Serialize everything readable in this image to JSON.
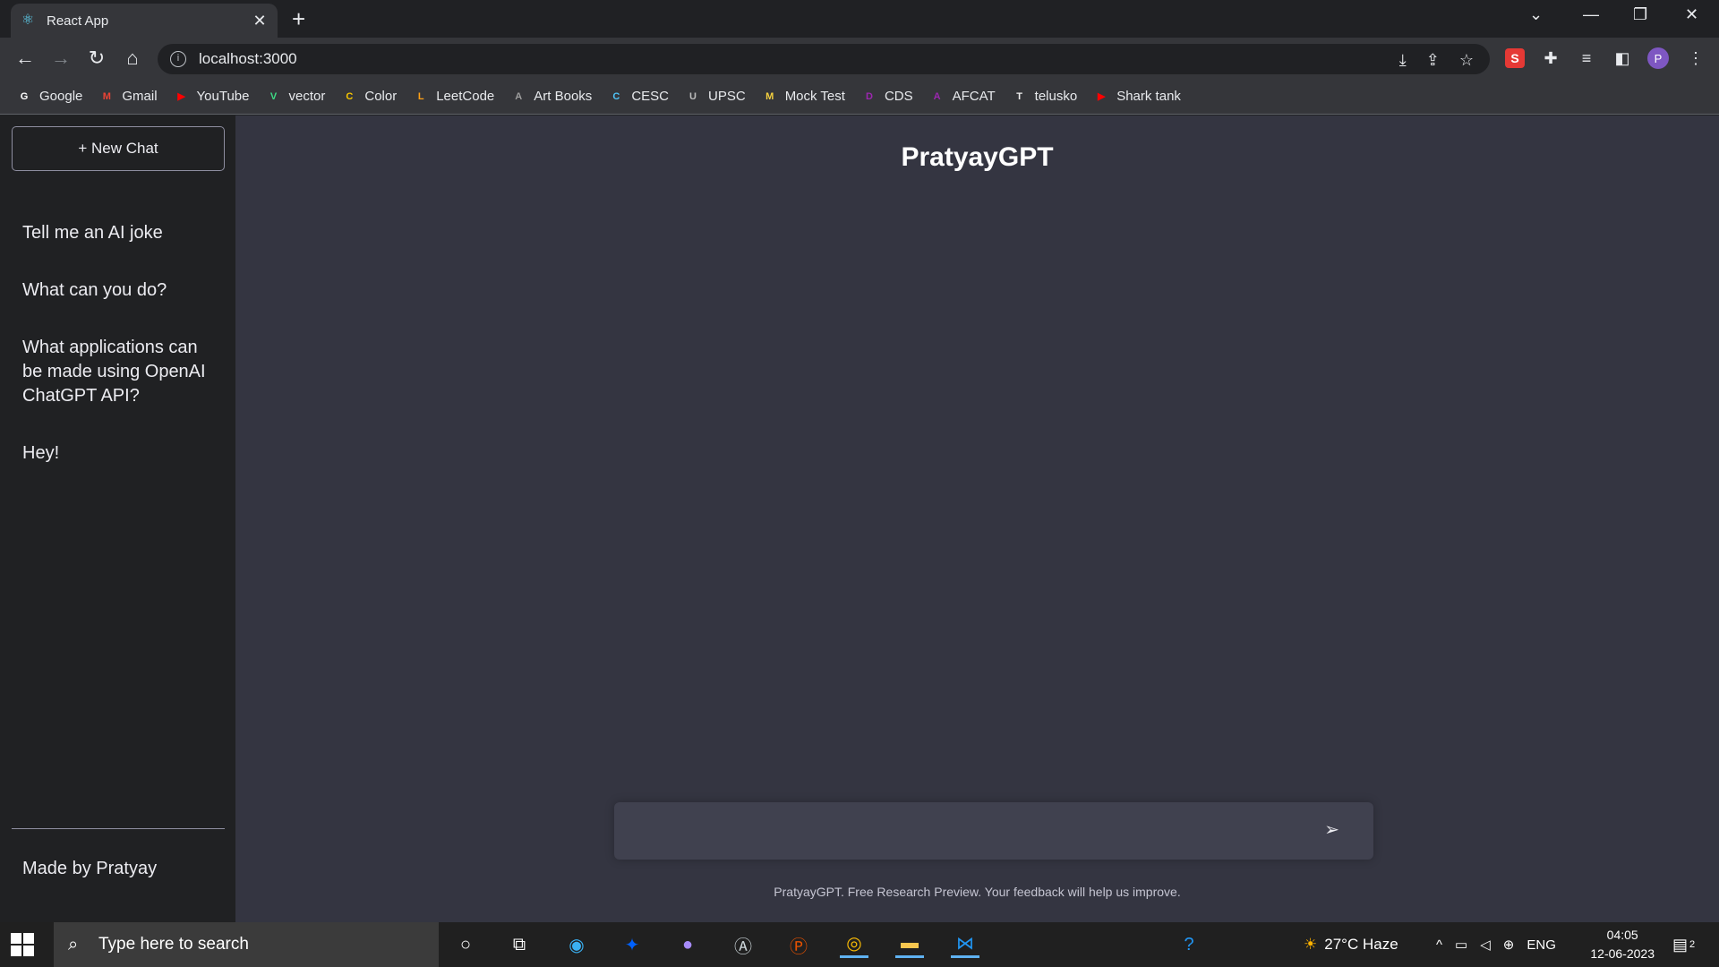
{
  "browser": {
    "tab_title": "React App",
    "tab_icon": "react-icon",
    "url": "localhost:3000",
    "profile_initial": "P",
    "ext_s_label": "S"
  },
  "bookmarks": [
    {
      "label": "Google",
      "icon": "G",
      "color": "#ffffff"
    },
    {
      "label": "Gmail",
      "icon": "M",
      "color": "#ea4335"
    },
    {
      "label": "YouTube",
      "icon": "▶",
      "color": "#ff0000"
    },
    {
      "label": "vector",
      "icon": "V",
      "color": "#3ddc84"
    },
    {
      "label": "Color",
      "icon": "C",
      "color": "#f5c400"
    },
    {
      "label": "LeetCode",
      "icon": "L",
      "color": "#ffa116"
    },
    {
      "label": "Art Books",
      "icon": "A",
      "color": "#9e9e9e"
    },
    {
      "label": "CESC",
      "icon": "C",
      "color": "#4fc3f7"
    },
    {
      "label": "UPSC",
      "icon": "U",
      "color": "#bdbdbd"
    },
    {
      "label": "Mock Test",
      "icon": "M",
      "color": "#f4d03f"
    },
    {
      "label": "CDS",
      "icon": "D",
      "color": "#9c27b0"
    },
    {
      "label": "AFCAT",
      "icon": "A",
      "color": "#9c27b0"
    },
    {
      "label": "telusko",
      "icon": "T",
      "color": "#eeeeee"
    },
    {
      "label": "Shark tank",
      "icon": "▶",
      "color": "#ff0000"
    }
  ],
  "sidebar": {
    "new_chat_label": "+ New Chat",
    "history": [
      "Tell me an AI joke",
      "What can you do?",
      "What applications can be made using OpenAI ChatGPT API?",
      "Hey!"
    ],
    "footer": "Made by Pratyay"
  },
  "main": {
    "brand": "PratyayGPT",
    "input_value": "",
    "send_icon": "➢",
    "footnote": "PratyayGPT. Free Research Preview. Your feedback will help us improve."
  },
  "taskbar": {
    "search_placeholder": "Type here to search",
    "weather": "27°C  Haze",
    "language": "ENG",
    "time": "04:05",
    "date": "12-06-2023",
    "notifications": "2"
  },
  "colors": {
    "sidebar_bg": "#202123",
    "main_bg": "#343541",
    "input_bg": "#40414f"
  }
}
